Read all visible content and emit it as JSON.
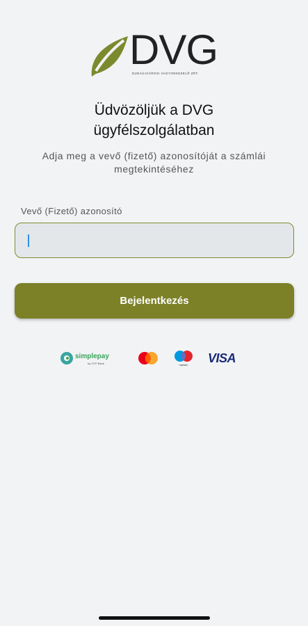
{
  "logo": {
    "brand": "DVG",
    "tagline": "DUNAÚJVÁROSI VAGYONKEZELŐ ZRT.",
    "leaf_color": "#7c8a2e"
  },
  "welcome": {
    "line1": "Üdvözöljük a DVG",
    "line2": "ügyfélszolgálatban"
  },
  "subtitle": {
    "line1": "Adja meg a vevő (fizető) azonosítóját a számlái",
    "line2": "megtekintéséhez"
  },
  "form": {
    "field_label": "Vevő (Fizető) azonosító",
    "field_value": "",
    "login_label": "Bejelentkezés"
  },
  "payments": {
    "simplepay": "simplepay",
    "simplepay_sub": "by OTP Bank",
    "visa": "VISA",
    "maestro_caption": "maestro"
  },
  "colors": {
    "accent": "#7c8128",
    "background": "#f2f3f5",
    "input_bg": "#e4e7ea"
  }
}
